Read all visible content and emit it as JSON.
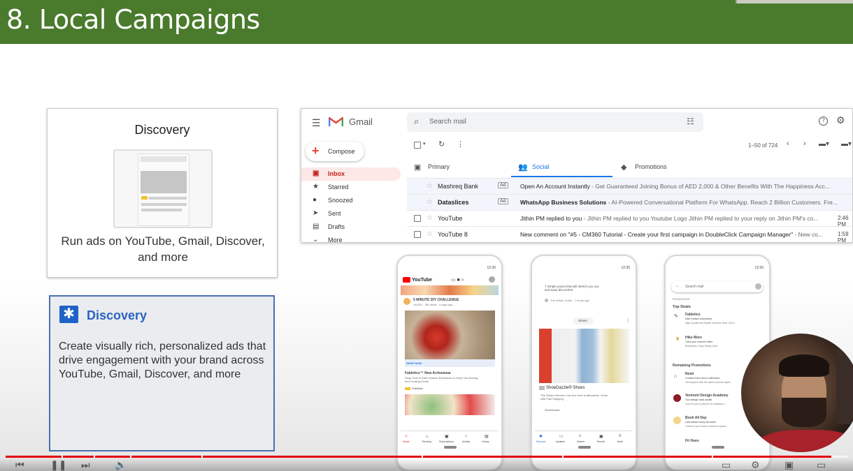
{
  "header": {
    "title": "8. Local Campaigns"
  },
  "card_discovery": {
    "title": "Discovery",
    "description": "Run ads on YouTube, Gmail, Discover, and more"
  },
  "card_discovery_detail": {
    "icon": "asterisk-icon",
    "title": "Discovery",
    "description": "Create visually rich, personalized ads that drive engagement with your brand across YouTube, Gmail, Discover, and more"
  },
  "gmail": {
    "app_name": "Gmail",
    "search_placeholder": "Search mail",
    "compose_label": "Compose",
    "nav": [
      {
        "label": "Inbox",
        "icon": "inbox-icon"
      },
      {
        "label": "Starred",
        "icon": "star-icon"
      },
      {
        "label": "Snoozed",
        "icon": "clock-icon"
      },
      {
        "label": "Sent",
        "icon": "send-icon"
      },
      {
        "label": "Drafts",
        "icon": "draft-icon"
      },
      {
        "label": "More",
        "icon": "chevron-down-icon"
      }
    ],
    "pagination": "1–50 of 724",
    "tabs": [
      {
        "label": "Primary",
        "icon": "inbox-icon"
      },
      {
        "label": "Social",
        "icon": "people-icon"
      },
      {
        "label": "Promotions",
        "icon": "tag-icon"
      }
    ],
    "rows": [
      {
        "sender": "Mashreq Bank",
        "badge": "Ad",
        "subject": "Open An Account Instantly",
        "snippet": " - Get Guaranteed Joining Bonus of AED 2,000 & Other Benefits With The Happiness Acc...",
        "time": ""
      },
      {
        "sender": "Dataslices",
        "badge": "Ad",
        "subject": "WhatsApp Business Solutions",
        "snippet": " - AI-Powered Conversational Platform For WhatsApp. Reach 2 Billion Customers. Fre...",
        "time": ""
      },
      {
        "sender": "YouTube",
        "badge": "",
        "subject": "Jithin PM replied to you",
        "snippet": " - Jithin PM replied to you Youtube Logo Jithin PM replied to your reply on Jithin PM's co...",
        "time": "2:46 PM"
      },
      {
        "sender": "YouTube 8",
        "badge": "",
        "subject": "New comment on \"#5 - CM360 Tutorial - Create your first campaign in DoubleClick Campaign Manager\"",
        "snippet": " - New co...",
        "time": "1:59 PM"
      }
    ]
  },
  "phone_youtube": {
    "status_time": "12:30",
    "app_name": "YouTube",
    "video_title": "5 MINUTE DIY CHALLENGE",
    "video_meta": "LauDIY · 3M views · 4 days ago",
    "cta": "SHOP NOW",
    "ad_title": "Fabletics™ New Activewear",
    "ad_desc": "Shop Tons of Kate Hudson Exclusives to Keep You Moving and Looking Great!",
    "advertiser": "Fabletics",
    "nav": [
      "Home",
      "Trending",
      "Subscriptions",
      "Activity",
      "Library"
    ]
  },
  "phone_discover": {
    "status_time": "12:30",
    "article_text": "7 simple poses that will stretch you out and ease discomfort",
    "article_meta": "The Whole Guide · 7 hours ago",
    "chip": "Shoes",
    "ad_title": "ShoeDazzle® Shoes",
    "ad_desc": "The Shoes Women Love Are Here & Affordable. Order with Fast Shipping.",
    "advertiser": "ShoeDazzle",
    "nav": [
      "Discover",
      "Updates",
      "Search",
      "Recent",
      "More"
    ]
  },
  "phone_gmail": {
    "status_time": "12:30",
    "search_placeholder": "Search mail",
    "section_label": "PROMOTIONS",
    "top_deals": "Top Deals",
    "deals": [
      {
        "name": "Fabletics",
        "line1": "Kate Hudson Activewear",
        "line2": "High-Quality and Stylish Workout Gear. Get 2..."
      },
      {
        "name": "Hike More",
        "line1": "Track your summer hikes",
        "line2": "Breathable, Easy Hiking Gear"
      }
    ],
    "remaining": "Remaining Promotions",
    "promos": [
      {
        "name": "Nesti",
        "line1": "Curated home decor collections",
        "line2": "Get inspired with the latest summer styles"
      },
      {
        "name": "Vermont Design Academy",
        "line1": "Your design class awaits",
        "line2": "If you've got a passion for drawing a..."
      },
      {
        "name": "Book All Day",
        "line1": "Last-minute luxury trip deals",
        "line2": "Travel to your heart's content at great..."
      },
      {
        "name": "Fit Hues",
        "line1": "",
        "line2": ""
      }
    ]
  },
  "player": {
    "progress_percent": 98
  }
}
